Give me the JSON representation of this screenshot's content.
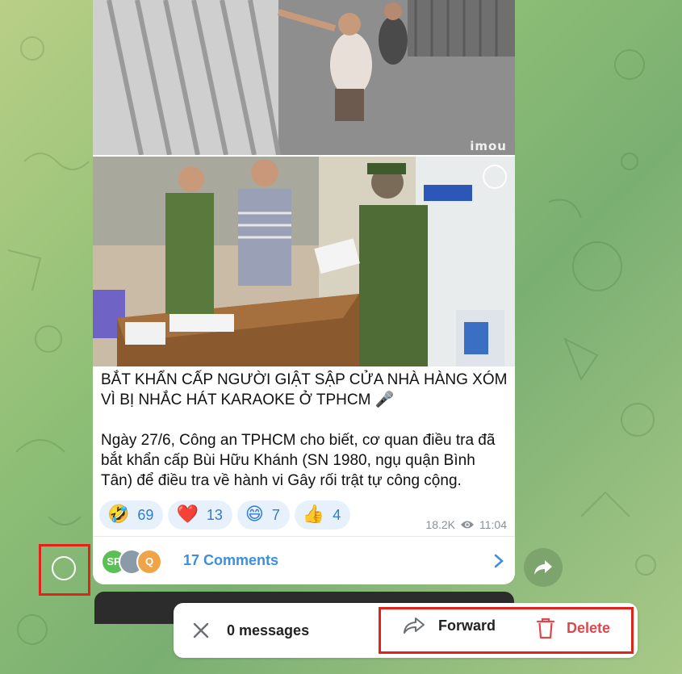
{
  "post": {
    "headline_line1": "BẮT KHẨN CẤP NGƯỜI GIẬT SẬP CỬA NHÀ HÀNG XÓM",
    "headline_line2": "VÌ BỊ NHẮC HÁT KARAOKE Ở TPHCM 🎤",
    "body_line1": "Ngày 27/6, Công an TPHCM cho biết, cơ quan điều tra đã",
    "body_line2": "bắt khẩn cấp Bùi Hữu Khánh (SN 1980, ngụ quận Bình",
    "body_line3": "Tân) để điều tra về hành vi Gây rối trật tự công cộng.",
    "photo1_watermark": "imou"
  },
  "reactions": [
    {
      "emoji": "🤣",
      "count": "69"
    },
    {
      "emoji": "❤️",
      "count": "13"
    },
    {
      "emoji": "😄",
      "count": "7"
    },
    {
      "emoji": "👍",
      "count": "4"
    }
  ],
  "meta": {
    "views": "18.2K",
    "time": "11:04"
  },
  "comments": {
    "label": "17 Comments",
    "avatars": [
      {
        "initials": "SP",
        "color": "#5cbf55"
      },
      {
        "initials": "",
        "color": "#8a9aa6"
      },
      {
        "initials": "Q",
        "color": "#f0a44a"
      }
    ]
  },
  "action_bar": {
    "count_label": "0 messages",
    "forward_label": "Forward",
    "delete_label": "Delete"
  },
  "colors": {
    "accent": "#3a8fe0",
    "danger": "#e0474c",
    "highlight": "#e0241b"
  }
}
